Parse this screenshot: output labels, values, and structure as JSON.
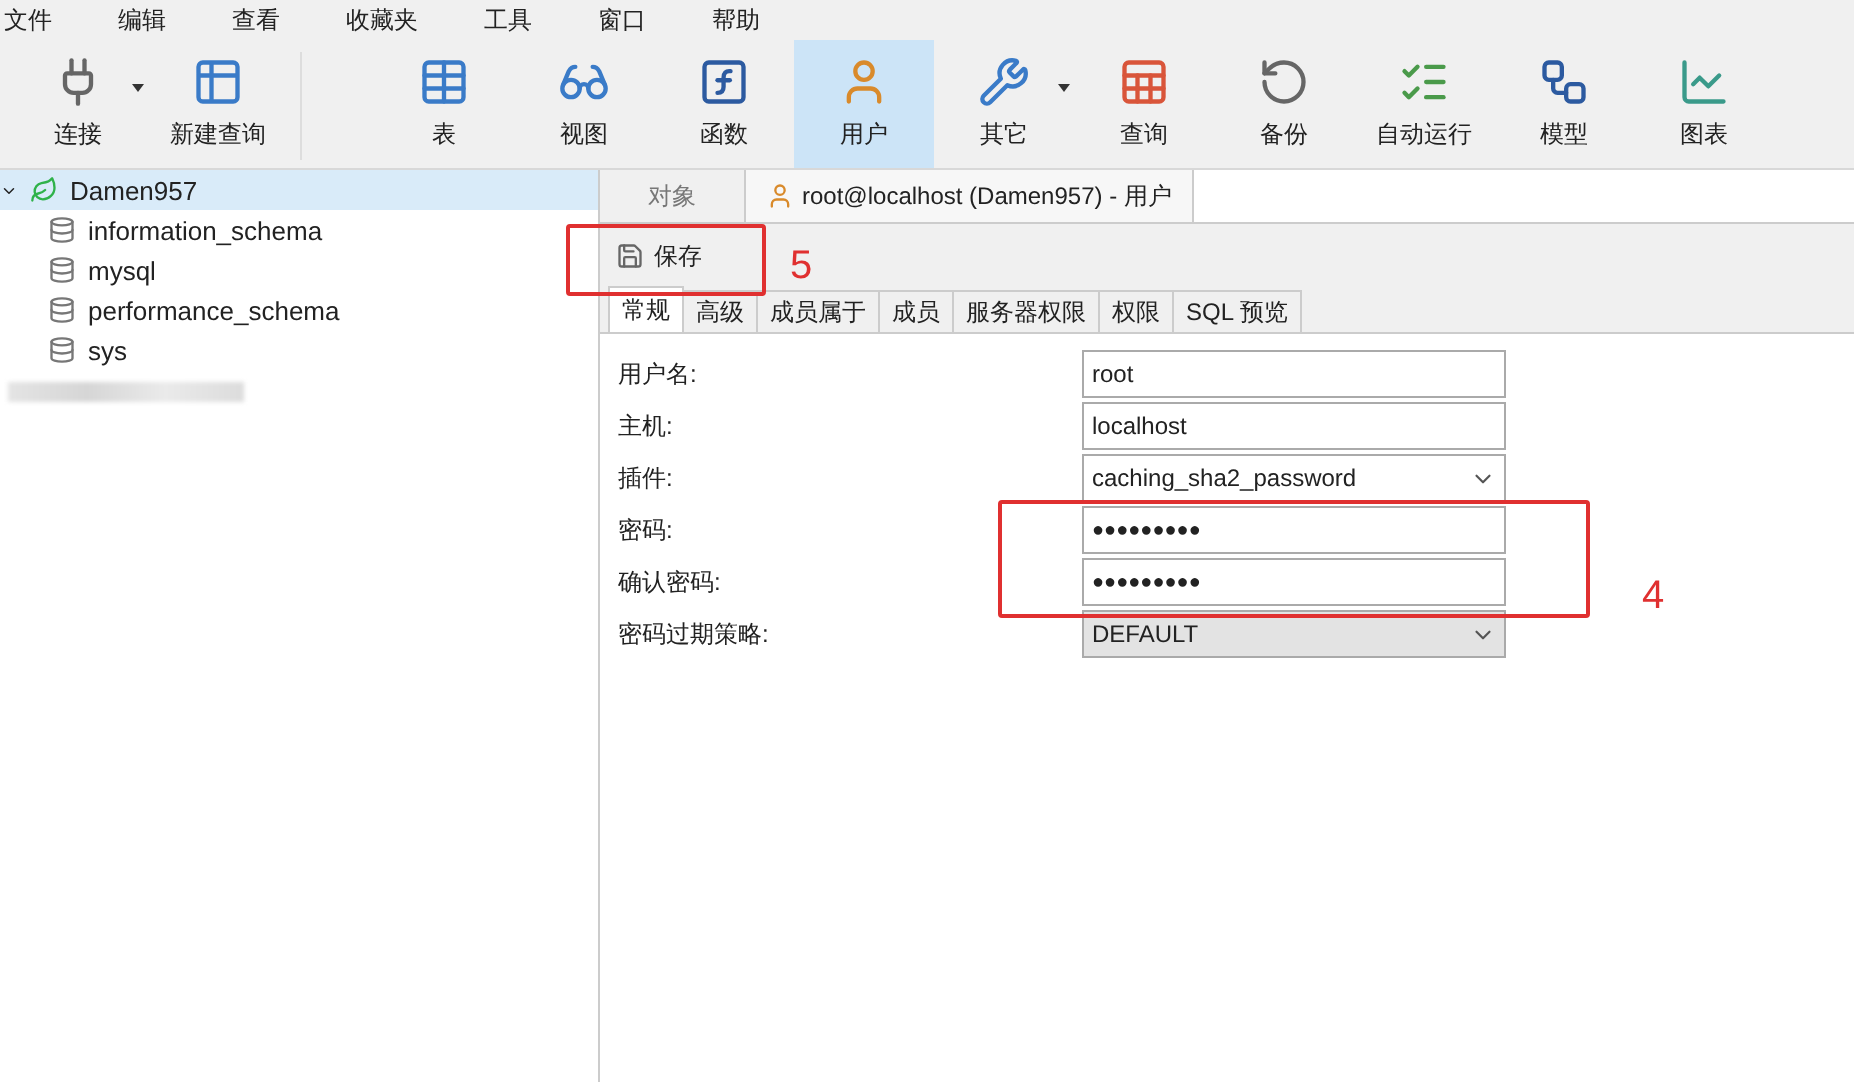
{
  "menu": [
    "文件",
    "编辑",
    "查看",
    "收藏夹",
    "工具",
    "窗口",
    "帮助"
  ],
  "toolbar": [
    {
      "label": "连接",
      "selected": false,
      "has_menu": true
    },
    {
      "label": "新建查询",
      "selected": false,
      "has_menu": false
    },
    {
      "label": "表",
      "selected": false,
      "has_menu": false
    },
    {
      "label": "视图",
      "selected": false,
      "has_menu": false
    },
    {
      "label": "函数",
      "selected": false,
      "has_menu": false
    },
    {
      "label": "用户",
      "selected": true,
      "has_menu": false
    },
    {
      "label": "其它",
      "selected": false,
      "has_menu": true
    },
    {
      "label": "查询",
      "selected": false,
      "has_menu": false
    },
    {
      "label": "备份",
      "selected": false,
      "has_menu": false
    },
    {
      "label": "自动运行",
      "selected": false,
      "has_menu": false
    },
    {
      "label": "模型",
      "selected": false,
      "has_menu": false
    },
    {
      "label": "图表",
      "selected": false,
      "has_menu": false
    }
  ],
  "tree": [
    {
      "label": "Damen957",
      "selected": true,
      "expanded": true,
      "children": [
        {
          "label": "information_schema",
          "selected": false
        },
        {
          "label": "mysql",
          "selected": false
        },
        {
          "label": "performance_schema",
          "selected": false
        },
        {
          "label": "sys",
          "selected": false
        }
      ]
    }
  ],
  "doc_tabs": [
    {
      "label": "对象",
      "selected": false
    },
    {
      "label": "root@localhost (Damen957) - 用户",
      "selected": true
    }
  ],
  "save_button": "保存",
  "sub_tabs": [
    {
      "label": "常规",
      "selected": true
    },
    {
      "label": "高级",
      "selected": false
    },
    {
      "label": "成员属于",
      "selected": false
    },
    {
      "label": "成员",
      "selected": false
    },
    {
      "label": "服务器权限",
      "selected": false
    },
    {
      "label": "权限",
      "selected": false
    },
    {
      "label": "SQL 预览",
      "selected": false
    }
  ],
  "form": [
    {
      "label": "用户名:",
      "kind": "text",
      "value": "root"
    },
    {
      "label": "主机:",
      "kind": "text",
      "value": "localhost"
    },
    {
      "label": "插件:",
      "kind": "select",
      "value": "caching_sha2_password"
    },
    {
      "label": "密码:",
      "kind": "password",
      "value": "●●●●●●●●●"
    },
    {
      "label": "确认密码:",
      "kind": "password",
      "value": "●●●●●●●●●"
    },
    {
      "label": "密码过期策略:",
      "kind": "combo",
      "value": "DEFAULT"
    }
  ],
  "annotations": [
    {
      "label": "5"
    },
    {
      "label": "4"
    }
  ]
}
